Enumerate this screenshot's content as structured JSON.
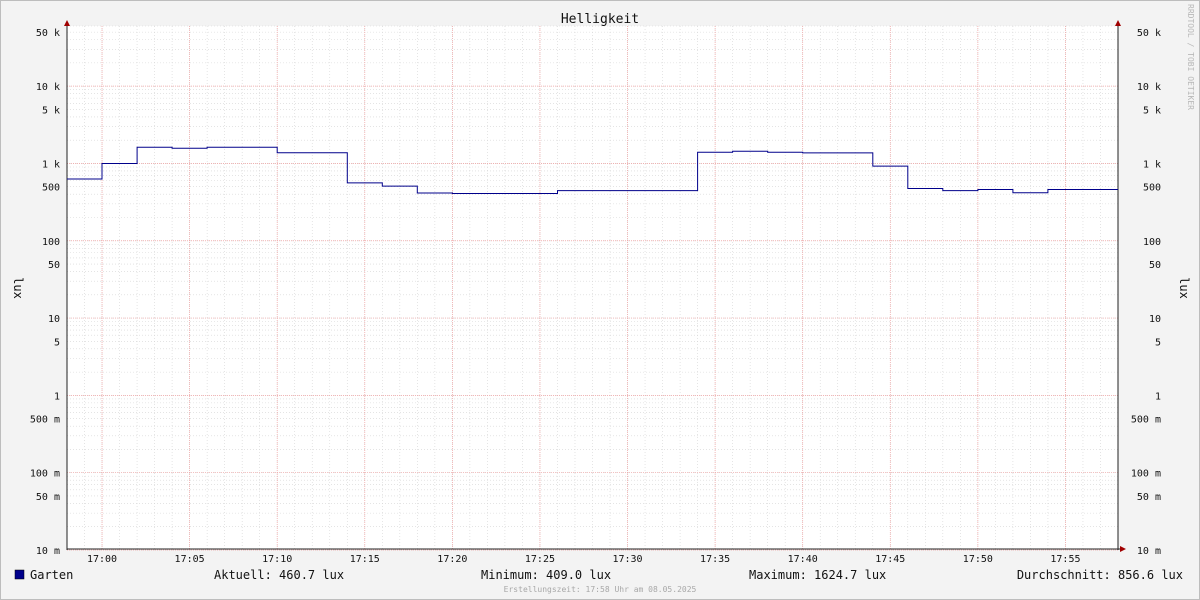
{
  "chart_data": {
    "type": "line",
    "title": "Helligkeit",
    "ylabel": "lux",
    "yscale": "log",
    "ylim": [
      0.01,
      60000
    ],
    "xlim": [
      "16:58",
      "17:58"
    ],
    "grid": true,
    "y_ticks": [
      {
        "value": 50000,
        "label": "50 k"
      },
      {
        "value": 10000,
        "label": "10 k"
      },
      {
        "value": 5000,
        "label": "5 k"
      },
      {
        "value": 1000,
        "label": "1 k"
      },
      {
        "value": 500,
        "label": "500"
      },
      {
        "value": 100,
        "label": "100"
      },
      {
        "value": 50,
        "label": "50"
      },
      {
        "value": 10,
        "label": "10"
      },
      {
        "value": 5,
        "label": "5"
      },
      {
        "value": 1,
        "label": "1"
      },
      {
        "value": 0.5,
        "label": "500 m"
      },
      {
        "value": 0.1,
        "label": "100 m"
      },
      {
        "value": 0.05,
        "label": "50 m"
      },
      {
        "value": 0.01,
        "label": "10 m"
      }
    ],
    "x_ticks": [
      "17:00",
      "17:05",
      "17:10",
      "17:15",
      "17:20",
      "17:25",
      "17:30",
      "17:35",
      "17:40",
      "17:45",
      "17:50",
      "17:55"
    ],
    "series": [
      {
        "name": "Garten",
        "color": "#00008b",
        "step": true,
        "points": [
          {
            "x": "16:58",
            "y": 630
          },
          {
            "x": "17:00",
            "y": 1000
          },
          {
            "x": "17:02",
            "y": 1624.7
          },
          {
            "x": "17:04",
            "y": 1570
          },
          {
            "x": "17:06",
            "y": 1624.7
          },
          {
            "x": "17:10",
            "y": 1380
          },
          {
            "x": "17:14",
            "y": 560
          },
          {
            "x": "17:16",
            "y": 510
          },
          {
            "x": "17:18",
            "y": 415
          },
          {
            "x": "17:20",
            "y": 409
          },
          {
            "x": "17:26",
            "y": 445
          },
          {
            "x": "17:34",
            "y": 1400
          },
          {
            "x": "17:36",
            "y": 1440
          },
          {
            "x": "17:38",
            "y": 1400
          },
          {
            "x": "17:40",
            "y": 1370
          },
          {
            "x": "17:44",
            "y": 925
          },
          {
            "x": "17:46",
            "y": 475
          },
          {
            "x": "17:48",
            "y": 445
          },
          {
            "x": "17:50",
            "y": 460
          },
          {
            "x": "17:52",
            "y": 418
          },
          {
            "x": "17:54",
            "y": 460.7
          },
          {
            "x": "17:58",
            "y": 460.7
          }
        ]
      }
    ]
  },
  "legend": {
    "series_name": "Garten",
    "swatch_color": "#00008b",
    "aktuell": "Aktuell: 460.7 lux",
    "minimum": "Minimum: 409.0 lux",
    "maximum": "Maximum: 1624.7 lux",
    "durchschnitt": "Durchschnitt: 856.6 lux"
  },
  "footer": "Erstellungszeit: 17:58 Uhr am 08.05.2025",
  "watermark": "RRDTOOL / TOBI OETIKER"
}
